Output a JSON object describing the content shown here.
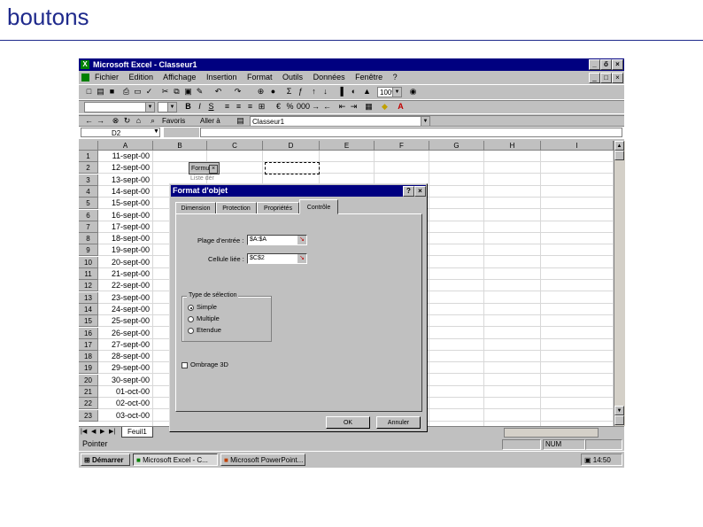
{
  "slide": {
    "title": "boutons"
  },
  "window": {
    "title": "Microsoft Excel - Classeur1",
    "controls": [
      "_",
      "ő",
      "×"
    ]
  },
  "menu": [
    "Fichier",
    "Edition",
    "Affichage",
    "Insertion",
    "Format",
    "Outils",
    "Données",
    "Fenêtre",
    "?"
  ],
  "toolbar": {
    "zoom": "100%",
    "forms_label": "Favoris",
    "goto_label": "Aller à",
    "address": "Classeur1"
  },
  "formula_bar": {
    "name_box": "D2"
  },
  "columns": [
    "A",
    "B",
    "C",
    "D",
    "E",
    "F",
    "G",
    "H",
    "I"
  ],
  "rows": [
    {
      "n": "1",
      "a": "11-sept-00"
    },
    {
      "n": "2",
      "a": "12-sept-00"
    },
    {
      "n": "3",
      "a": "13-sept-00"
    },
    {
      "n": "4",
      "a": "14-sept-00"
    },
    {
      "n": "5",
      "a": "15-sept-00"
    },
    {
      "n": "6",
      "a": "16-sept-00"
    },
    {
      "n": "7",
      "a": "17-sept-00"
    },
    {
      "n": "8",
      "a": "18-sept-00"
    },
    {
      "n": "9",
      "a": "19-sept-00"
    },
    {
      "n": "10",
      "a": "20-sept-00"
    },
    {
      "n": "11",
      "a": "21-sept-00"
    },
    {
      "n": "12",
      "a": "22-sept-00"
    },
    {
      "n": "13",
      "a": "23-sept-00"
    },
    {
      "n": "14",
      "a": "24-sept-00"
    },
    {
      "n": "15",
      "a": "25-sept-00"
    },
    {
      "n": "16",
      "a": "26-sept-00"
    },
    {
      "n": "17",
      "a": "27-sept-00"
    },
    {
      "n": "18",
      "a": "28-sept-00"
    },
    {
      "n": "19",
      "a": "29-sept-00"
    },
    {
      "n": "20",
      "a": "30-sept-00"
    },
    {
      "n": "21",
      "a": "01-oct-00"
    },
    {
      "n": "22",
      "a": "02-oct-00"
    },
    {
      "n": "23",
      "a": "03-oct-00"
    }
  ],
  "form_control": {
    "label": "Formul",
    "sub": "Liste dér"
  },
  "sheet_tab": "Feuil1",
  "status": {
    "mode": "Pointer",
    "num": "NUM"
  },
  "taskbar": {
    "start": "Démarrer",
    "excel": "Microsoft Excel - C...",
    "ppt": "Microsoft PowerPoint...",
    "clock": "14:50"
  },
  "dialog": {
    "title": "Format d'objet",
    "help_btn": "?",
    "close_btn": "×",
    "tabs": [
      "Dimension",
      "Protection",
      "Propriétés",
      "Contrôle"
    ],
    "input_range_label": "Plage d'entrée :",
    "input_range_value": "$A:$A",
    "cell_link_label": "Cellule liée :",
    "cell_link_value": "$C$2",
    "group_title": "Type de sélection",
    "radio_simple": "Simple",
    "radio_multiple": "Multiple",
    "radio_extended": "Etendue",
    "shading_label": "Ombrage 3D",
    "ok": "OK",
    "cancel": "Annuler"
  }
}
